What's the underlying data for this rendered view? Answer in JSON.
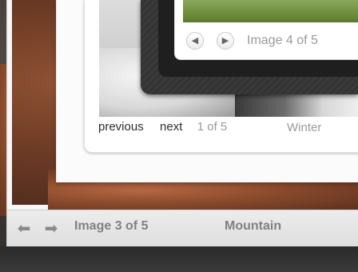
{
  "top_gallery": {
    "prev_icon": "left-arrow-icon",
    "next_icon": "right-arrow-icon",
    "counter": "Image 4 of 5"
  },
  "middle_gallery": {
    "previous_label": "previous",
    "next_label": "next",
    "counter": "1 of 5",
    "caption": "Winter"
  },
  "bottom_gallery": {
    "prev_icon": "left-arrow-icon",
    "next_icon": "right-arrow-icon",
    "counter": "Image 3 of 5",
    "caption": "Mountain"
  }
}
